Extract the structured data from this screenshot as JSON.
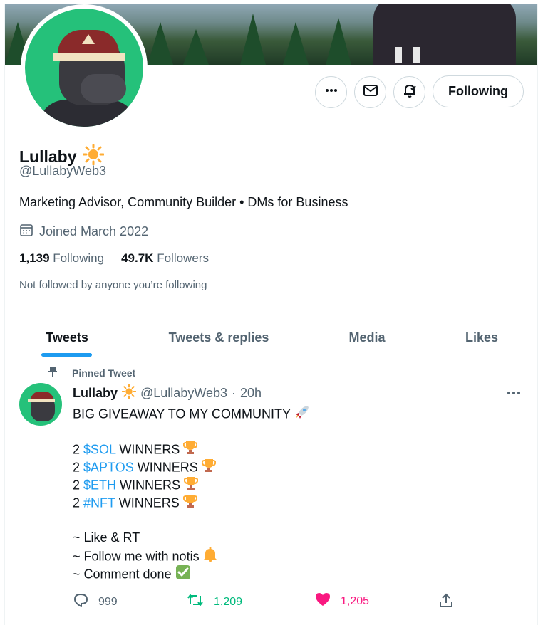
{
  "profile": {
    "name": "Lullaby",
    "handle": "@LullabyWeb3",
    "bio": "Marketing Advisor, Community Builder • DMs for Business",
    "joined": "Joined March 2022",
    "following_count": "1,139",
    "following_label": "Following",
    "followers_count": "49.7K",
    "followers_label": "Followers",
    "not_followed": "Not followed by anyone you’re following",
    "follow_button": "Following"
  },
  "tabs": [
    {
      "label": "Tweets",
      "active": true
    },
    {
      "label": "Tweets & replies",
      "active": false
    },
    {
      "label": "Media",
      "active": false
    },
    {
      "label": "Likes",
      "active": false
    }
  ],
  "tweet": {
    "pinned_label": "Pinned Tweet",
    "author": "Lullaby",
    "handle": "@LullabyWeb3",
    "separator": "·",
    "time": "20h",
    "lines": {
      "l1": "BIG GIVEAWAY TO MY COMMUNITY",
      "l2_pre": "2 ",
      "l2_tag": "$SOL",
      "l2_post": " WINNERS",
      "l3_pre": "2 ",
      "l3_tag": "$APTOS",
      "l3_post": " WINNERS",
      "l4_pre": "2 ",
      "l4_tag": "$ETH",
      "l4_post": " WINNERS",
      "l5_pre": "2 ",
      "l5_tag": "#NFT",
      "l5_post": " WINNERS",
      "l6": "~ Like & RT",
      "l7": "~ Follow me with notis",
      "l8": "~ Comment done"
    },
    "replies": "999",
    "retweets": "1,209",
    "likes": "1,205"
  },
  "colors": {
    "accent": "#1d9bf0",
    "retweet": "#00ba7c",
    "like": "#f91880",
    "avatar_bg": "#25c17a"
  }
}
